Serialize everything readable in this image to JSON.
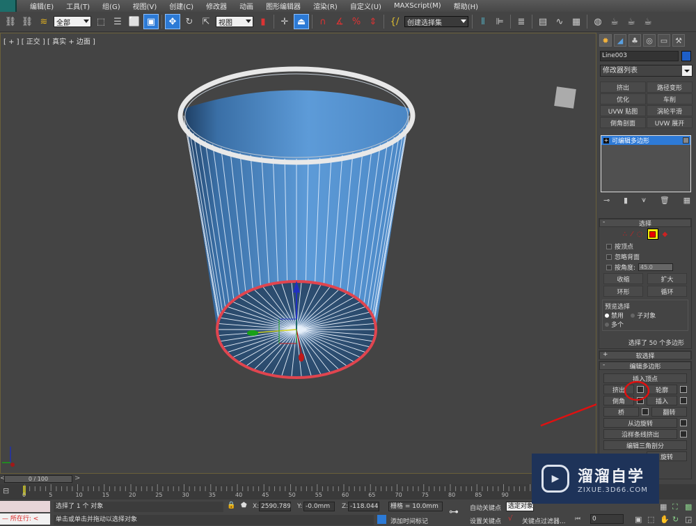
{
  "menubar": {
    "items": [
      "编辑(E)",
      "工具(T)",
      "组(G)",
      "视图(V)",
      "创建(C)",
      "修改器",
      "动画",
      "图形编辑器",
      "渲染(R)",
      "自定义(U)",
      "MAXScript(M)",
      "帮助(H)"
    ]
  },
  "toolbar": {
    "selection_filter": "全部",
    "reference_coord": "视图",
    "named_selection": "创建选择集"
  },
  "viewport": {
    "label": "[ + ] [ 正交 ] [ 真实 + 边面 ]",
    "subject": "cup mesh with selected bottom polygon"
  },
  "command_panel": {
    "tabs": [
      "create-icon",
      "modify-icon",
      "hierarchy-icon",
      "motion-icon",
      "display-icon",
      "utilities-icon"
    ],
    "object_name": "Line003",
    "object_color": "#1e5fc7",
    "modifier_list": "修改器列表",
    "modifier_buttons": [
      "挤出",
      "路径变形",
      "优化",
      "车削",
      "UVW 贴图",
      "涡轮平滑",
      "倒角剖面",
      "UVW 展开"
    ],
    "stack_item": "可编辑多边形",
    "selection": {
      "title": "选择",
      "by_vertex": "按顶点",
      "ignore_backfacing": "忽略背面",
      "by_angle": "按角度:",
      "angle_value": "45.0",
      "shrink": "收缩",
      "grow": "扩大",
      "ring": "环形",
      "loop": "循环",
      "preview_title": "预览选择",
      "preview_options": [
        "禁用",
        "子对象",
        "多个"
      ],
      "preview_selected": "禁用",
      "status": "选择了 50 个多边形"
    },
    "soft_selection": "软选择",
    "edit_polygons": {
      "title": "编辑多边形",
      "insert_vertex": "插入顶点",
      "extrude": "挤出",
      "outline": "轮廓",
      "bevel": "倒角",
      "inset": "插入",
      "bridge": "桥",
      "flip": "翻转",
      "hinge_from_edge": "从边旋转",
      "extrude_along_spline": "沿样条线挤出",
      "edit_triangulation": "编辑三角剖分",
      "turn": "旋转"
    }
  },
  "timeline": {
    "frame_display": "0 / 100",
    "ticks": [
      0,
      5,
      10,
      15,
      20,
      25,
      30,
      35,
      40,
      45,
      50,
      55,
      60,
      65,
      70,
      75,
      80,
      85,
      90
    ]
  },
  "status_bar": {
    "maxscript_label": "所在行:",
    "selection_status": "选择了 1 个 对象",
    "prompt": "单击或单击并拖动以选择对象",
    "x_label": "X:",
    "x_value": "2590.789m",
    "y_label": "Y:",
    "y_value": "-0.0mm",
    "z_label": "Z:",
    "z_value": "-118.044m",
    "grid": "栅格 = 10.0mm",
    "add_time_tag": "添加时间标记",
    "auto_key": "自动关键点",
    "selected_dropdown": "选定对象",
    "set_key": "设置关键点",
    "key_filters": "关键点过滤器...",
    "current_frame": "0"
  },
  "watermark": {
    "brand_cn": "溜溜自学",
    "brand_url": "ZIXUE.3D66.COM"
  }
}
